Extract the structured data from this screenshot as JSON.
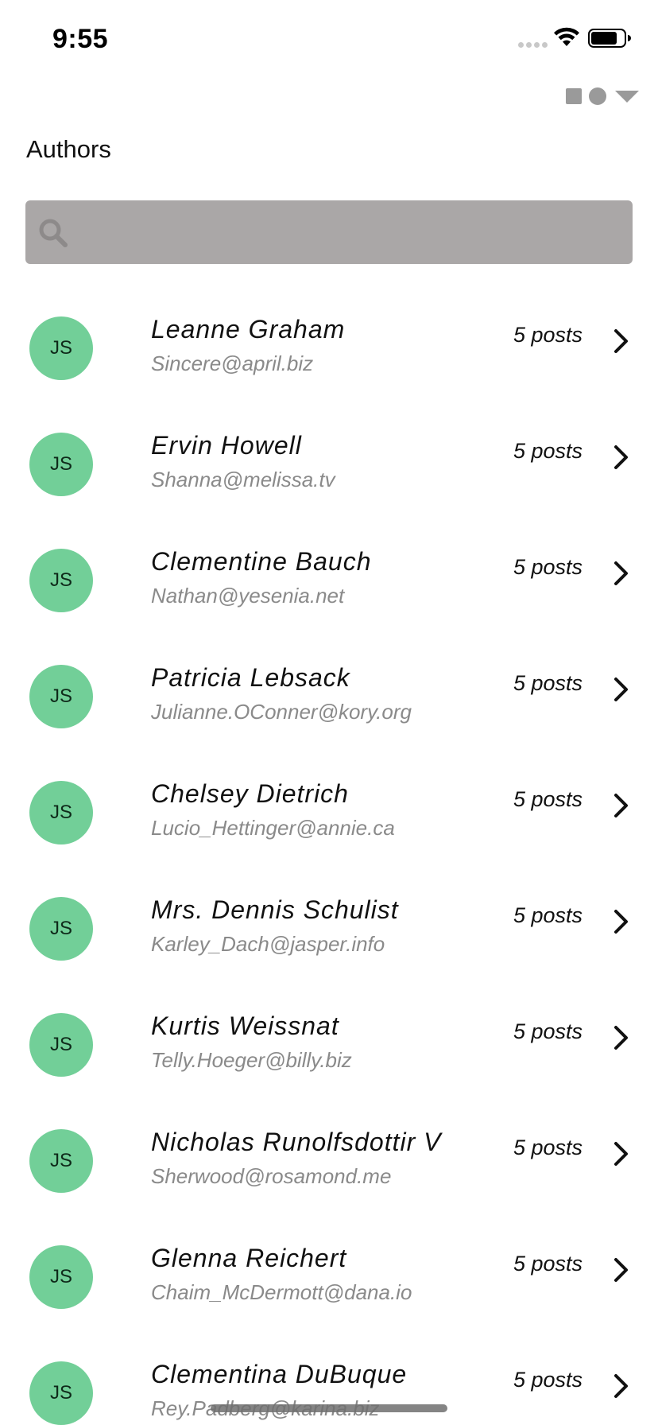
{
  "status_bar": {
    "time": "9:55"
  },
  "overlay": {
    "icons": [
      "square-icon",
      "circle-icon",
      "triangle-down-icon"
    ]
  },
  "header": {
    "title": "Authors"
  },
  "search": {
    "value": "",
    "placeholder": "",
    "icon": "search-icon"
  },
  "colors": {
    "avatar_bg": "#72cf98",
    "search_bg": "#aaa7a7",
    "email_text": "#8a8a8a"
  },
  "authors": [
    {
      "initials": "JS",
      "name": "Leanne Graham",
      "email": "Sincere@april.biz",
      "posts": "5 posts"
    },
    {
      "initials": "JS",
      "name": "Ervin Howell",
      "email": "Shanna@melissa.tv",
      "posts": "5 posts"
    },
    {
      "initials": "JS",
      "name": "Clementine Bauch",
      "email": "Nathan@yesenia.net",
      "posts": "5 posts"
    },
    {
      "initials": "JS",
      "name": "Patricia Lebsack",
      "email": "Julianne.OConner@kory.org",
      "posts": "5 posts"
    },
    {
      "initials": "JS",
      "name": "Chelsey Dietrich",
      "email": "Lucio_Hettinger@annie.ca",
      "posts": "5 posts"
    },
    {
      "initials": "JS",
      "name": "Mrs. Dennis Schulist",
      "email": "Karley_Dach@jasper.info",
      "posts": "5 posts"
    },
    {
      "initials": "JS",
      "name": "Kurtis Weissnat",
      "email": "Telly.Hoeger@billy.biz",
      "posts": "5 posts"
    },
    {
      "initials": "JS",
      "name": "Nicholas Runolfsdottir V",
      "email": "Sherwood@rosamond.me",
      "posts": "5 posts"
    },
    {
      "initials": "JS",
      "name": "Glenna Reichert",
      "email": "Chaim_McDermott@dana.io",
      "posts": "5 posts"
    },
    {
      "initials": "JS",
      "name": "Clementina DuBuque",
      "email": "Rey.Padberg@karina.biz",
      "posts": "5 posts"
    }
  ]
}
